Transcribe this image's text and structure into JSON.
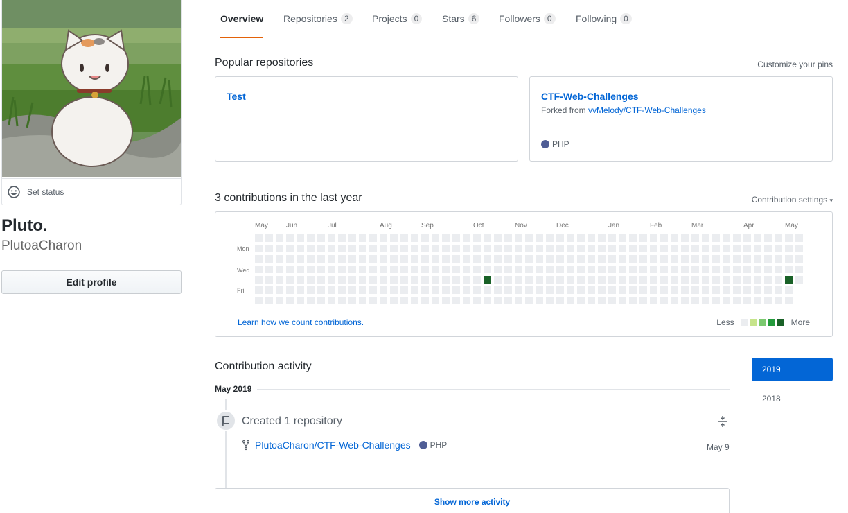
{
  "profile": {
    "set_status": "Set status",
    "full_name": "Pluto.",
    "login": "PlutoaCharon",
    "edit_profile": "Edit profile"
  },
  "tabs": [
    {
      "label": "Overview",
      "count": null
    },
    {
      "label": "Repositories",
      "count": "2"
    },
    {
      "label": "Projects",
      "count": "0"
    },
    {
      "label": "Stars",
      "count": "6"
    },
    {
      "label": "Followers",
      "count": "0"
    },
    {
      "label": "Following",
      "count": "0"
    }
  ],
  "popular": {
    "title": "Popular repositories",
    "customize": "Customize your pins",
    "pins": [
      {
        "name": "Test"
      },
      {
        "name": "CTF-Web-Challenges",
        "forked_prefix": "Forked from ",
        "forked_from": "vvMelody/CTF-Web-Challenges",
        "language": "PHP",
        "language_color": "#4F5D95"
      }
    ]
  },
  "contributions": {
    "title": "3 contributions in the last year",
    "settings": "Contribution settings",
    "months": [
      "May",
      "Jun",
      "Jul",
      "Aug",
      "Sep",
      "Oct",
      "Nov",
      "Dec",
      "Jan",
      "Feb",
      "Mar",
      "Apr",
      "May"
    ],
    "days": [
      "Mon",
      "Wed",
      "Fri"
    ],
    "learn_link": "Learn how we count contributions.",
    "legend_less": "Less",
    "legend_more": "More",
    "legend_colors": [
      "#ebedf0",
      "#c6e48b",
      "#7bc96f",
      "#239a3b",
      "#196127"
    ],
    "active_cells": [
      {
        "week": 22,
        "day": 4,
        "color": "#196127"
      },
      {
        "week": 51,
        "day": 4,
        "color": "#196127"
      }
    ]
  },
  "activity": {
    "title": "Contribution activity",
    "years": [
      "2019",
      "2018"
    ],
    "active_year": "2019",
    "period": "May 2019",
    "event_title": "Created 1 repository",
    "repo": "PlutoaCharon/CTF-Web-Challenges",
    "language": "PHP",
    "date": "May 9",
    "show_more": "Show more activity"
  }
}
